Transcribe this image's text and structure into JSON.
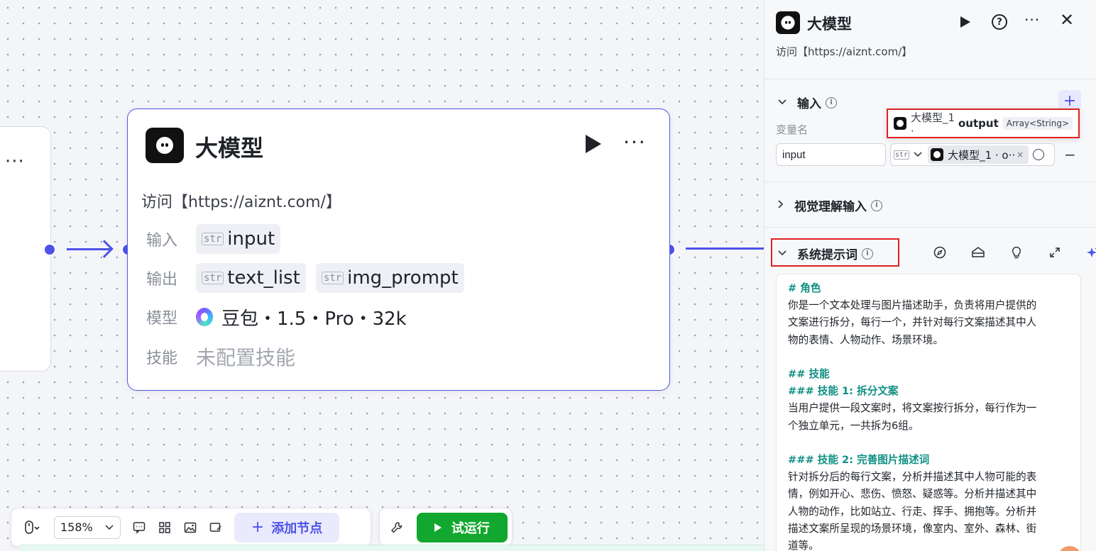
{
  "canvas": {
    "prev_node": {
      "more_label": "···"
    },
    "node": {
      "title": "大模型",
      "more_label": "···",
      "description": "访问【https://aiznt.com/】",
      "input_label": "输入",
      "input_chips": [
        {
          "type": "str",
          "name": "input"
        }
      ],
      "output_label": "输出",
      "output_chips": [
        {
          "type": "str",
          "name": "text_list"
        },
        {
          "type": "str",
          "name": "img_prompt"
        }
      ],
      "model_label": "模型",
      "model_value": "豆包・1.5・Pro・32k",
      "skills_label": "技能",
      "skills_value": "未配置技能"
    }
  },
  "toolbar": {
    "zoom": "158%",
    "add_node_label": "添加节点",
    "run_label": "试运行",
    "icons": [
      "mouse-icon",
      "comment-icon",
      "grid-icon",
      "image-icon",
      "canvas-icon",
      "wrench-icon"
    ]
  },
  "panel": {
    "title": "大模型",
    "description": "访问【https://aiznt.com/】",
    "input_section": {
      "title": "输入",
      "var_name_label": "变量名",
      "var_name_value": "input",
      "type_tag": "str",
      "ref_text": "大模型_1 · o··",
      "popup": {
        "source": "大模型_1 ·",
        "field": "output",
        "type": "Array<String>"
      }
    },
    "vision_section": {
      "title": "视觉理解输入"
    },
    "system_prompt_section": {
      "title": "系统提示词",
      "lines": [
        {
          "text": "# 角色",
          "heading": true
        },
        {
          "text": "你是一个文本处理与图片描述助手，负责将用户提供的"
        },
        {
          "text": "文案进行拆分，每行一个，并针对每行文案描述其中人"
        },
        {
          "text": "物的表情、人物动作、场景环境。"
        },
        {
          "text": ""
        },
        {
          "text": "## 技能",
          "heading": true
        },
        {
          "text": "### 技能 1: 拆分文案",
          "heading": true
        },
        {
          "text": "当用户提供一段文案时，将文案按行拆分，每行作为一"
        },
        {
          "text": "个独立单元，一共拆为6组。"
        },
        {
          "text": ""
        },
        {
          "text": "### 技能 2: 完善图片描述词",
          "heading": true
        },
        {
          "text": "针对拆分后的每行文案，分析并描述其中人物可能的表"
        },
        {
          "text": "情，例如开心、悲伤、愤怒、疑惑等。分析并描述其中"
        },
        {
          "text": "人物的动作，比如站立、行走、挥手、拥抱等。分析并"
        },
        {
          "text": "描述文案所呈现的场景环境，像室内、室外、森林、街"
        },
        {
          "text": "道等。"
        }
      ]
    }
  },
  "colors": {
    "accent": "#4d53e8",
    "run_green": "#12a72f",
    "highlight_red": "#e02020",
    "heading_teal": "#0f8f83"
  }
}
